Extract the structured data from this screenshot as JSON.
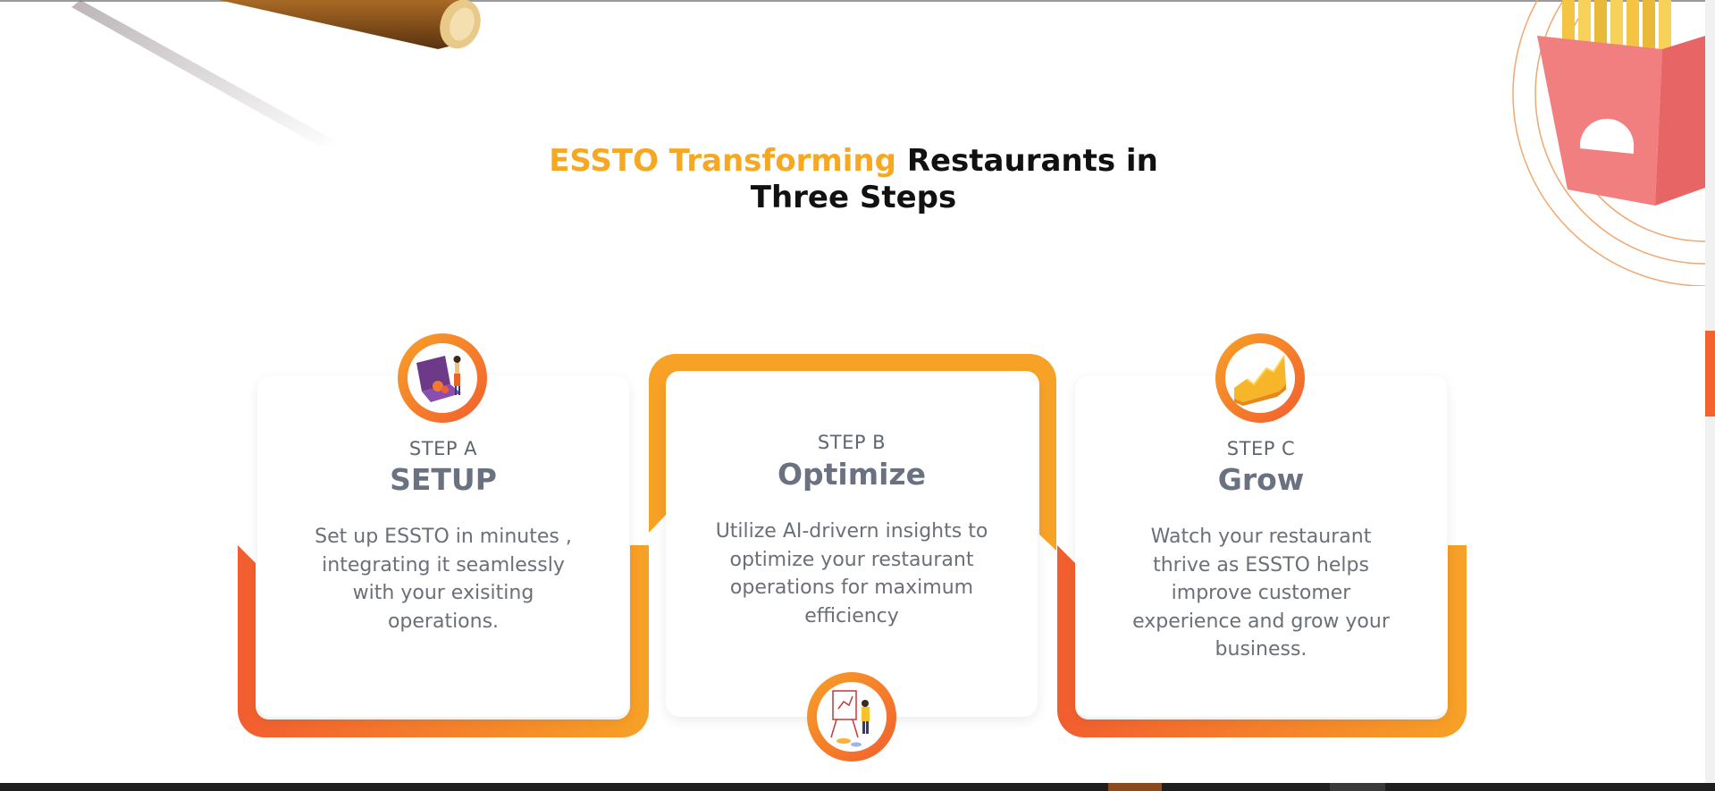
{
  "heading": {
    "accent": "ESSTO Transforming",
    "rest_line1": "Restaurants in",
    "line2": "Three Steps"
  },
  "steps": [
    {
      "label": "STEP A",
      "title": "SETUP",
      "description": "Set up ESSTO in minutes , integrating it seamlessly with your exisiting operations.",
      "icon": "laptop-setup-icon"
    },
    {
      "label": "STEP B",
      "title": "Optimize",
      "description": "Utilize AI-drivern insights to optimize your restaurant operations for maximum efficiency",
      "icon": "presentation-board-icon"
    },
    {
      "label": "STEP C",
      "title": "Grow",
      "description": "Watch your restaurant thrive as ESSTO helps improve customer experience and grow your business.",
      "icon": "growth-chart-icon"
    }
  ],
  "colors": {
    "accent_yellow": "#f7a823",
    "gradient_orange": "#f7a127",
    "gradient_red": "#f25e2f",
    "title_gray": "#6a7180",
    "text_gray": "#6b6f77"
  }
}
